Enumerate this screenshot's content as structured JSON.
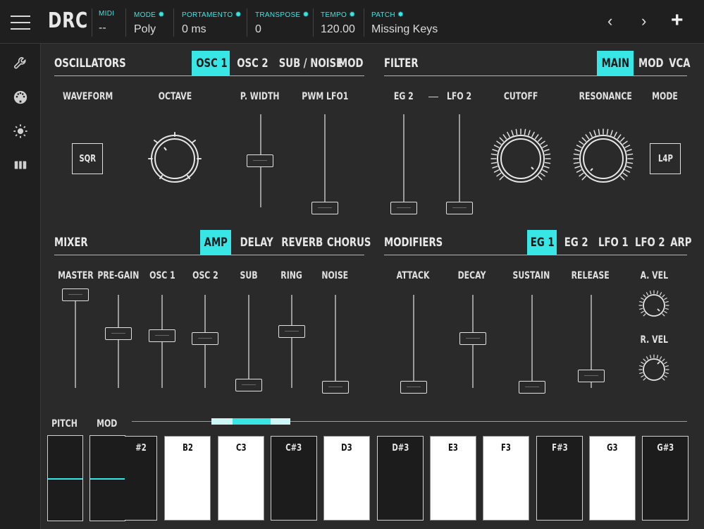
{
  "app": {
    "logo": "DRC"
  },
  "topbar": {
    "fields": [
      {
        "label": "MIDI",
        "value": "--",
        "gear": false
      },
      {
        "label": "MODE",
        "value": "Poly",
        "gear": true
      },
      {
        "label": "PORTAMENTO",
        "value": "0 ms",
        "gear": true
      },
      {
        "label": "TRANSPOSE",
        "value": "0",
        "gear": true
      },
      {
        "label": "TEMPO",
        "value": "120.00",
        "gear": true
      },
      {
        "label": "PATCH",
        "value": "Missing Keys",
        "gear": true
      }
    ],
    "prev": "‹",
    "next": "›",
    "add": "+"
  },
  "sidebar": {
    "icons": [
      "wrench-icon",
      "midi-connector-icon",
      "brightness-icon",
      "tape-icon"
    ]
  },
  "oscillators": {
    "title": "OSCILLATORS",
    "tabs": [
      {
        "label": "OSC 1",
        "active": true
      },
      {
        "label": "OSC 2"
      },
      {
        "label": "SUB / NOISE"
      },
      {
        "label": "MOD"
      }
    ],
    "params": {
      "waveform": "WAVEFORM",
      "octave": "OCTAVE",
      "pwidth": "P. WIDTH",
      "pwm": "PWM LFO1"
    },
    "waveform_value": "SQR",
    "pwidth_level": 0.5,
    "pwm_level": 0.0
  },
  "filter": {
    "title": "FILTER",
    "tabs": [
      {
        "label": "MAIN",
        "active": true
      },
      {
        "label": "MOD"
      },
      {
        "label": "VCA"
      }
    ],
    "params": {
      "eg2": "EG 2",
      "dash": "—",
      "lfo2": "LFO 2",
      "cutoff": "CUTOFF",
      "resonance": "RESONANCE",
      "mode": "MODE"
    },
    "mode_value": "L4P",
    "eg2_level": 0.0,
    "lfo2_level": 0.0
  },
  "mixer": {
    "title": "MIXER",
    "tabs": [
      {
        "label": "AMP",
        "active": true
      },
      {
        "label": "DELAY"
      },
      {
        "label": "REVERB"
      },
      {
        "label": "CHORUS"
      }
    ],
    "sliders": [
      {
        "label": "MASTER",
        "level": 1.0
      },
      {
        "label": "PRE-GAIN",
        "level": 0.55
      },
      {
        "label": "OSC 1",
        "level": 0.55
      },
      {
        "label": "OSC 2",
        "level": 0.5
      },
      {
        "label": "SUB",
        "level": 0.0
      },
      {
        "label": "RING",
        "level": 0.6
      },
      {
        "label": "NOISE",
        "level": 0.0
      }
    ]
  },
  "modifiers": {
    "title": "MODIFIERS",
    "tabs": [
      {
        "label": "EG 1",
        "active": true
      },
      {
        "label": "EG 2"
      },
      {
        "label": "LFO 1"
      },
      {
        "label": "LFO 2"
      },
      {
        "label": "ARP"
      }
    ],
    "sliders": [
      {
        "label": "ATTACK",
        "level": 0.0
      },
      {
        "label": "DECAY",
        "level": 0.55
      },
      {
        "label": "SUSTAIN",
        "level": 0.0
      },
      {
        "label": "RELEASE",
        "level": 0.12
      }
    ],
    "avel": "A. VEL",
    "rvel": "R. VEL"
  },
  "keyboard": {
    "pitch": "PITCH",
    "mod": "MOD",
    "keys": [
      {
        "label": "#2",
        "type": "black"
      },
      {
        "label": "B2",
        "type": "white"
      },
      {
        "label": "C3",
        "type": "white"
      },
      {
        "label": "C#3",
        "type": "black"
      },
      {
        "label": "D3",
        "type": "white"
      },
      {
        "label": "D#3",
        "type": "black"
      },
      {
        "label": "E3",
        "type": "white"
      },
      {
        "label": "F3",
        "type": "white"
      },
      {
        "label": "F#3",
        "type": "black"
      },
      {
        "label": "G3",
        "type": "white"
      },
      {
        "label": "G#3",
        "type": "black"
      }
    ]
  },
  "colors": {
    "accent": "#38e6e6",
    "background": "#2a2a2a",
    "panel": "#1f1f1f"
  }
}
